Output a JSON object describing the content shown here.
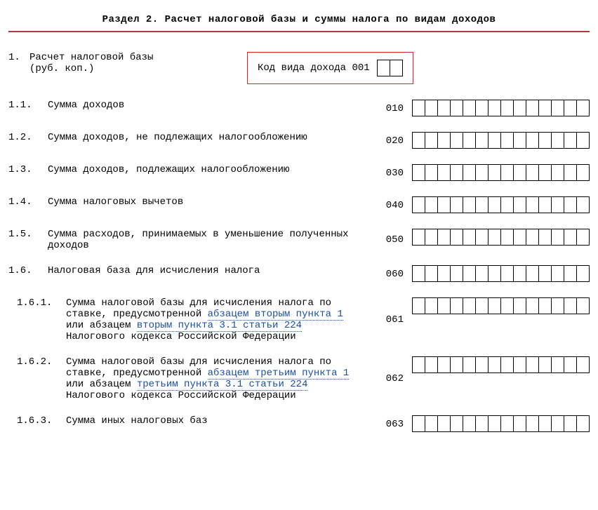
{
  "title": "Раздел 2. Расчет налоговой базы и суммы налога по видам доходов",
  "top": {
    "num": "1.",
    "label_line1": "Расчет налоговой базы",
    "label_line2": "(руб. коп.)",
    "code_label": "Код вида дохода",
    "code_value": "001"
  },
  "rows": [
    {
      "num": "1.1.",
      "label": "Сумма доходов",
      "code": "010"
    },
    {
      "num": "1.2.",
      "label": "Сумма доходов, не подлежащих налогообложению",
      "code": "020"
    },
    {
      "num": "1.3.",
      "label": "Сумма доходов, подлежащих налогообложению",
      "code": "030"
    },
    {
      "num": "1.4.",
      "label": "Сумма налоговых вычетов",
      "code": "040"
    },
    {
      "num": "1.5.",
      "label": "Сумма расходов, принимаемых в уменьшение полученных доходов",
      "code": "050"
    },
    {
      "num": "1.6.",
      "label": "Налоговая база для исчисления налога",
      "code": "060"
    }
  ],
  "row161": {
    "num": "1.6.1.",
    "pre": "Сумма налоговой базы для исчисления налога по ставке, предусмотренной ",
    "link1": "абзацем вторым пункта 1",
    "mid": " или абзацем ",
    "link2": "вторым пункта 3.1 статьи 224",
    "post": " Налогового кодекса Российской Федерации",
    "code": "061"
  },
  "row162": {
    "num": "1.6.2.",
    "pre": "Сумма налоговой базы для исчисления налога по ставке, предусмотренной ",
    "link1": "абзацем третьим пункта 1",
    "mid": " или абзацем ",
    "link2": "третьим пункта 3.1 статьи 224",
    "post": " Налогового кодекса Российской Федерации",
    "code": "062"
  },
  "row163": {
    "num": "1.6.3.",
    "label": "Сумма иных налоговых баз",
    "code": "063"
  }
}
